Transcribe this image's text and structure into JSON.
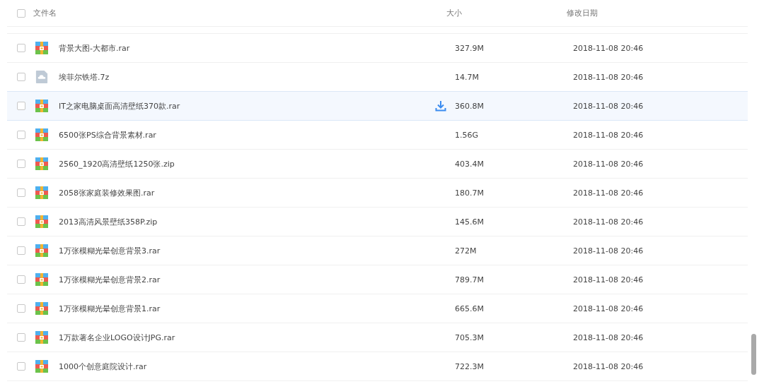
{
  "header": {
    "select_all": {
      "checked": false
    },
    "columns": [
      "文件名",
      "大小",
      "修改日期"
    ]
  },
  "rows": [
    {
      "name": "背景大图-大都市.rar",
      "size": "327.9M",
      "date": "2018-11-08 20:46",
      "kind": "archive",
      "checked": false,
      "hovered": false
    },
    {
      "name": "埃菲尔铁塔.7z",
      "size": "14.7M",
      "date": "2018-11-08 20:46",
      "kind": "cloud",
      "checked": false,
      "hovered": false
    },
    {
      "name": "IT之家电脑桌面高清壁纸370款.rar",
      "size": "360.8M",
      "date": "2018-11-08 20:46",
      "kind": "archive",
      "checked": false,
      "hovered": true
    },
    {
      "name": "6500张PS综合背景素材.rar",
      "size": "1.56G",
      "date": "2018-11-08 20:46",
      "kind": "archive",
      "checked": false,
      "hovered": false
    },
    {
      "name": "2560_1920高清壁纸1250张.zip",
      "size": "403.4M",
      "date": "2018-11-08 20:46",
      "kind": "archive",
      "checked": false,
      "hovered": false
    },
    {
      "name": "2058张家庭装修效果图.rar",
      "size": "180.7M",
      "date": "2018-11-08 20:46",
      "kind": "archive",
      "checked": false,
      "hovered": false
    },
    {
      "name": "2013高清风景壁纸358P.zip",
      "size": "145.6M",
      "date": "2018-11-08 20:46",
      "kind": "archive",
      "checked": false,
      "hovered": false
    },
    {
      "name": "1万张模糊光晕创意背景3.rar",
      "size": "272M",
      "date": "2018-11-08 20:46",
      "kind": "archive",
      "checked": false,
      "hovered": false
    },
    {
      "name": "1万张模糊光晕创意背景2.rar",
      "size": "789.7M",
      "date": "2018-11-08 20:46",
      "kind": "archive",
      "checked": false,
      "hovered": false
    },
    {
      "name": "1万张模糊光晕创意背景1.rar",
      "size": "665.6M",
      "date": "2018-11-08 20:46",
      "kind": "archive",
      "checked": false,
      "hovered": false
    },
    {
      "name": "1万款著名企业LOGO设计JPG.rar",
      "size": "705.3M",
      "date": "2018-11-08 20:46",
      "kind": "archive",
      "checked": false,
      "hovered": false
    },
    {
      "name": "1000个创意庭院设计.rar",
      "size": "722.3M",
      "date": "2018-11-08 20:46",
      "kind": "archive",
      "checked": false,
      "hovered": false
    }
  ]
}
